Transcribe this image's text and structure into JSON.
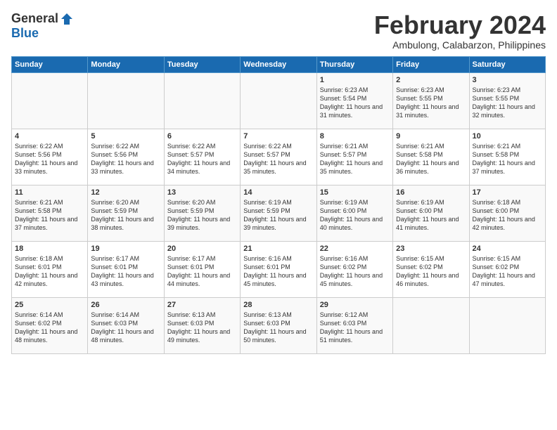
{
  "header": {
    "logo_general": "General",
    "logo_blue": "Blue",
    "month_title": "February 2024",
    "location": "Ambulong, Calabarzon, Philippines"
  },
  "days_of_week": [
    "Sunday",
    "Monday",
    "Tuesday",
    "Wednesday",
    "Thursday",
    "Friday",
    "Saturday"
  ],
  "weeks": [
    [
      {
        "day": "",
        "content": ""
      },
      {
        "day": "",
        "content": ""
      },
      {
        "day": "",
        "content": ""
      },
      {
        "day": "",
        "content": ""
      },
      {
        "day": "1",
        "content": "Sunrise: 6:23 AM\nSunset: 5:54 PM\nDaylight: 11 hours and 31 minutes."
      },
      {
        "day": "2",
        "content": "Sunrise: 6:23 AM\nSunset: 5:55 PM\nDaylight: 11 hours and 31 minutes."
      },
      {
        "day": "3",
        "content": "Sunrise: 6:23 AM\nSunset: 5:55 PM\nDaylight: 11 hours and 32 minutes."
      }
    ],
    [
      {
        "day": "4",
        "content": "Sunrise: 6:22 AM\nSunset: 5:56 PM\nDaylight: 11 hours and 33 minutes."
      },
      {
        "day": "5",
        "content": "Sunrise: 6:22 AM\nSunset: 5:56 PM\nDaylight: 11 hours and 33 minutes."
      },
      {
        "day": "6",
        "content": "Sunrise: 6:22 AM\nSunset: 5:57 PM\nDaylight: 11 hours and 34 minutes."
      },
      {
        "day": "7",
        "content": "Sunrise: 6:22 AM\nSunset: 5:57 PM\nDaylight: 11 hours and 35 minutes."
      },
      {
        "day": "8",
        "content": "Sunrise: 6:21 AM\nSunset: 5:57 PM\nDaylight: 11 hours and 35 minutes."
      },
      {
        "day": "9",
        "content": "Sunrise: 6:21 AM\nSunset: 5:58 PM\nDaylight: 11 hours and 36 minutes."
      },
      {
        "day": "10",
        "content": "Sunrise: 6:21 AM\nSunset: 5:58 PM\nDaylight: 11 hours and 37 minutes."
      }
    ],
    [
      {
        "day": "11",
        "content": "Sunrise: 6:21 AM\nSunset: 5:58 PM\nDaylight: 11 hours and 37 minutes."
      },
      {
        "day": "12",
        "content": "Sunrise: 6:20 AM\nSunset: 5:59 PM\nDaylight: 11 hours and 38 minutes."
      },
      {
        "day": "13",
        "content": "Sunrise: 6:20 AM\nSunset: 5:59 PM\nDaylight: 11 hours and 39 minutes."
      },
      {
        "day": "14",
        "content": "Sunrise: 6:19 AM\nSunset: 5:59 PM\nDaylight: 11 hours and 39 minutes."
      },
      {
        "day": "15",
        "content": "Sunrise: 6:19 AM\nSunset: 6:00 PM\nDaylight: 11 hours and 40 minutes."
      },
      {
        "day": "16",
        "content": "Sunrise: 6:19 AM\nSunset: 6:00 PM\nDaylight: 11 hours and 41 minutes."
      },
      {
        "day": "17",
        "content": "Sunrise: 6:18 AM\nSunset: 6:00 PM\nDaylight: 11 hours and 42 minutes."
      }
    ],
    [
      {
        "day": "18",
        "content": "Sunrise: 6:18 AM\nSunset: 6:01 PM\nDaylight: 11 hours and 42 minutes."
      },
      {
        "day": "19",
        "content": "Sunrise: 6:17 AM\nSunset: 6:01 PM\nDaylight: 11 hours and 43 minutes."
      },
      {
        "day": "20",
        "content": "Sunrise: 6:17 AM\nSunset: 6:01 PM\nDaylight: 11 hours and 44 minutes."
      },
      {
        "day": "21",
        "content": "Sunrise: 6:16 AM\nSunset: 6:01 PM\nDaylight: 11 hours and 45 minutes."
      },
      {
        "day": "22",
        "content": "Sunrise: 6:16 AM\nSunset: 6:02 PM\nDaylight: 11 hours and 45 minutes."
      },
      {
        "day": "23",
        "content": "Sunrise: 6:15 AM\nSunset: 6:02 PM\nDaylight: 11 hours and 46 minutes."
      },
      {
        "day": "24",
        "content": "Sunrise: 6:15 AM\nSunset: 6:02 PM\nDaylight: 11 hours and 47 minutes."
      }
    ],
    [
      {
        "day": "25",
        "content": "Sunrise: 6:14 AM\nSunset: 6:02 PM\nDaylight: 11 hours and 48 minutes."
      },
      {
        "day": "26",
        "content": "Sunrise: 6:14 AM\nSunset: 6:03 PM\nDaylight: 11 hours and 48 minutes."
      },
      {
        "day": "27",
        "content": "Sunrise: 6:13 AM\nSunset: 6:03 PM\nDaylight: 11 hours and 49 minutes."
      },
      {
        "day": "28",
        "content": "Sunrise: 6:13 AM\nSunset: 6:03 PM\nDaylight: 11 hours and 50 minutes."
      },
      {
        "day": "29",
        "content": "Sunrise: 6:12 AM\nSunset: 6:03 PM\nDaylight: 11 hours and 51 minutes."
      },
      {
        "day": "",
        "content": ""
      },
      {
        "day": "",
        "content": ""
      }
    ]
  ]
}
